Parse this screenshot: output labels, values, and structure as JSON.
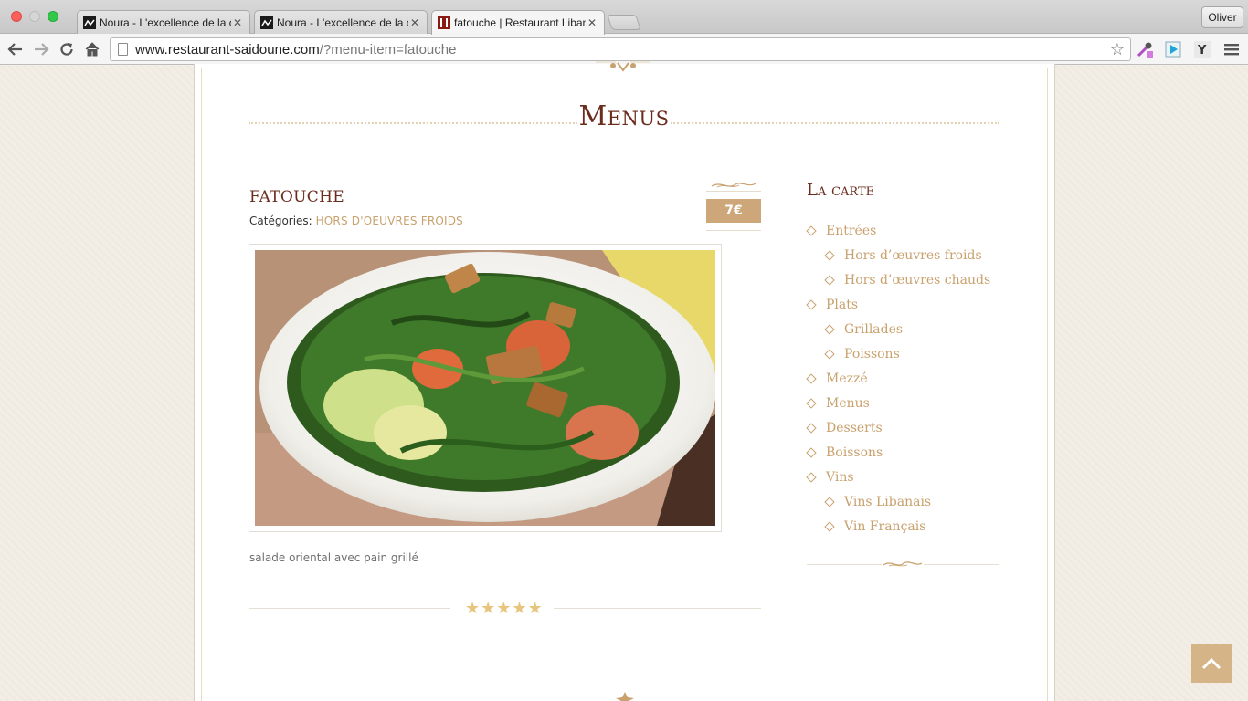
{
  "browser": {
    "tabs": [
      {
        "title": "Noura - L'excellence de la c",
        "active": false
      },
      {
        "title": "Noura - L'excellence de la c",
        "active": false
      },
      {
        "title": "fatouche | Restaurant Liban",
        "active": true
      }
    ],
    "tab_close_glyph": "✕",
    "profile_name": "Oliver",
    "url_host": "www.restaurant-saidoune.com",
    "url_path": "/?menu-item=fatouche",
    "icons": [
      "back-icon",
      "forward-icon",
      "reload-icon",
      "home-icon",
      "page-icon",
      "bookmark-star-icon",
      "eyedropper-extension-icon",
      "cast-extension-icon",
      "y-extension-icon",
      "menu-icon"
    ]
  },
  "page": {
    "section_title": "Menus",
    "item": {
      "name": "FATOUCHE",
      "categories_label": "Catégories:",
      "category": "HORS D'OEUVRES FROIDS",
      "price": "7€",
      "description": "salade oriental avec pain grillé",
      "rating": 5,
      "rating_glyphs": "★★★★★"
    },
    "sidebar": {
      "title": "La carte",
      "items": [
        {
          "label": "Entrées",
          "level": 0
        },
        {
          "label": "Hors d’œuvres froids",
          "level": 1
        },
        {
          "label": "Hors d’œuvres chauds",
          "level": 1
        },
        {
          "label": "Plats",
          "level": 0
        },
        {
          "label": "Grillades",
          "level": 1
        },
        {
          "label": "Poissons",
          "level": 1
        },
        {
          "label": "Mezzé",
          "level": 0
        },
        {
          "label": "Menus",
          "level": 0
        },
        {
          "label": "Desserts",
          "level": 0
        },
        {
          "label": "Boissons",
          "level": 0
        },
        {
          "label": "Vins",
          "level": 0
        },
        {
          "label": "Vins Libanais",
          "level": 1
        },
        {
          "label": "Vin Français",
          "level": 1
        }
      ]
    },
    "colors": {
      "heading": "#6b2c1e",
      "accent": "#c8a16e",
      "price_bg": "#cda77a",
      "star": "#e8c57d",
      "back_to_top_bg": "#d5b488"
    }
  }
}
